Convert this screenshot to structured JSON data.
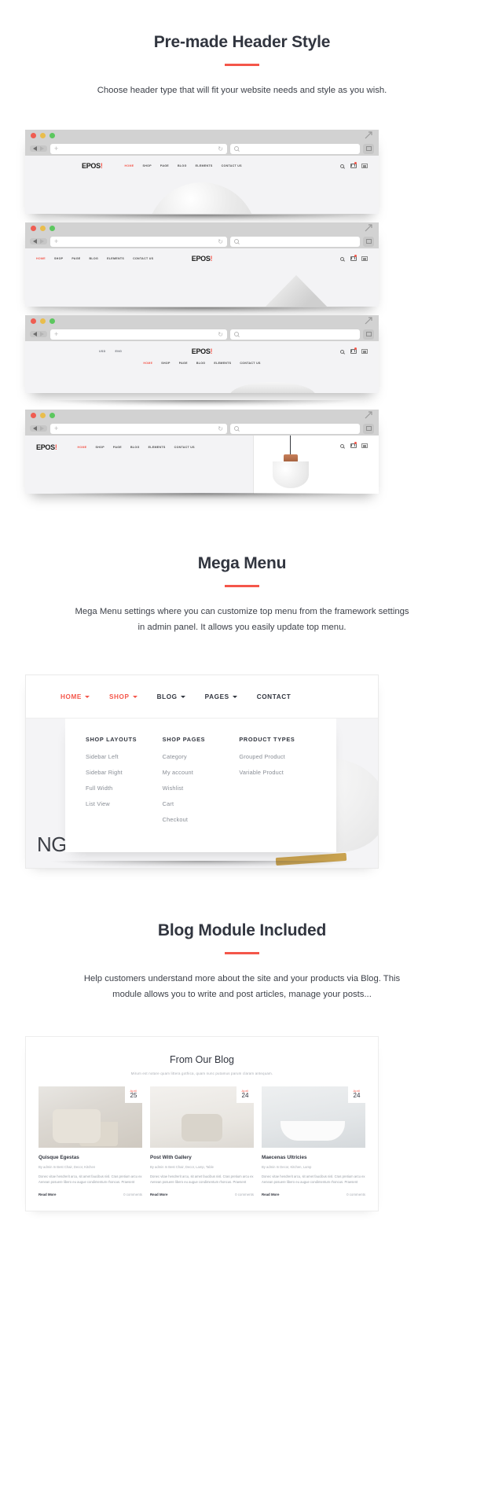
{
  "sections": {
    "header_style": {
      "title": "Pre-made Header Style",
      "desc": "Choose header type that will fit your website needs and style as you wish."
    },
    "mega_menu": {
      "title": "Mega Menu",
      "desc": "Mega Menu settings where you can customize top menu from the framework settings in admin panel.  It allows you easily update top menu."
    },
    "blog_module": {
      "title": "Blog Module Included",
      "desc": "Help customers understand more about the site and your products via Blog. This module allows you to write and post articles, manage your posts..."
    }
  },
  "browser": {
    "url_placeholder": "",
    "search_placeholder": "",
    "plus_label": "+",
    "reload_label": "↻"
  },
  "site": {
    "logo_main": "EPOS",
    "logo_accent": "!",
    "menu": [
      "HOME",
      "SHOP",
      "PAGE",
      "BLOG",
      "ELEMENTS",
      "CONTACT US"
    ],
    "active_menu": "HOME",
    "selectors": [
      "USD",
      "ENG"
    ],
    "hero_text": "NG PRODUCT!"
  },
  "mega": {
    "top_menu": [
      {
        "label": "HOME",
        "caret": true,
        "active": true
      },
      {
        "label": "SHOP",
        "caret": true,
        "active": true
      },
      {
        "label": "BLOG",
        "caret": true,
        "active": false
      },
      {
        "label": "PAGES",
        "caret": true,
        "active": false
      },
      {
        "label": "CONTACT",
        "caret": false,
        "active": false
      }
    ],
    "columns": [
      {
        "heading": "SHOP LAYOUTS",
        "links": [
          "Sidebar Left",
          "Sidebar Right",
          "Full Width",
          "List View"
        ]
      },
      {
        "heading": "SHOP PAGES",
        "links": [
          "Category",
          "My account",
          "Wishlist",
          "Cart",
          "Checkout"
        ]
      },
      {
        "heading": "PRODUCT TYPES",
        "links": [
          "Grouped Product",
          "Variable Product"
        ]
      }
    ]
  },
  "blog": {
    "heading": "From Our Blog",
    "subheading": "Mirum est notare quam littera gothica, quam nunc putamus parum claram antequam.",
    "posts": [
      {
        "month": "April",
        "day": "25",
        "title": "Quisque Egestas",
        "byline": "By admin  In Best Chair, Decor, Kitchen",
        "excerpt": "Donec vitae hendrerit arcu, sit amet faucibus nisl. Cras pretium arcu ex Aenean posuere libero eu augue condimentum rhoncus. Praesent",
        "read_more": "Read More",
        "comments": "0 comments"
      },
      {
        "month": "April",
        "day": "24",
        "title": "Post With Gallery",
        "byline": "By admin  In Best Chair, Decor, Lamp, Table",
        "excerpt": "Donec vitae hendrerit arcu, sit amet faucibus nisl. Cras pretium arcu ex Aenean posuere libero eu augue condimentum rhoncus. Praesent",
        "read_more": "Read More",
        "comments": "0 comments"
      },
      {
        "month": "April",
        "day": "24",
        "title": "Maecenas Ultricies",
        "byline": "By admin  In Decor, Kitchen, Lamp",
        "excerpt": "Donec vitae hendrerit arcu, sit amet faucibus nisl. Cras pretium arcu ex Aenean posuere libero eu augue condimentum rhoncus. Praesent",
        "read_more": "Read More",
        "comments": "0 comments"
      }
    ]
  },
  "colors": {
    "accent": "#f4564a",
    "heading": "#31353f",
    "muted": "#9aa0a7"
  }
}
